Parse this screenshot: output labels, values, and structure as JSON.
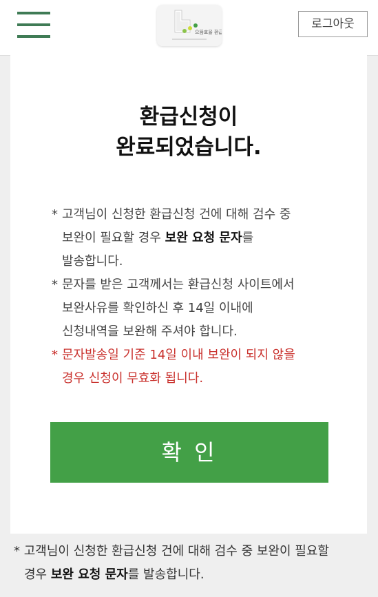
{
  "header": {
    "logout_label": "로그아웃",
    "logo_text": "으뜸효율 환급사업",
    "accent_color": "#3f7b55"
  },
  "main": {
    "title_line1": "환급신청이",
    "title_line2": "완료되었습니다.",
    "notes": [
      {
        "star": "*",
        "line1": "고객님이 신청한 환급신청 건에 대해 검수 중",
        "line2_pre": "보완이 필요할 경우 ",
        "line2_bold": "보완 요청 문자",
        "line2_post": "를",
        "line3": "발송합니다."
      },
      {
        "star": "*",
        "line1": "문자를 받은 고객께서는 환급신청 사이트에서",
        "line2": "보완사유를 확인하신 후 14일 이내에",
        "line3": "신청내역을 보완해 주셔야 합니다."
      },
      {
        "star": "*",
        "line1": "문자발송일 기준 14일 이내 보완이 되지 않을",
        "line2": "경우 신청이 무효화 됩니다.",
        "color": "#c9302c"
      }
    ],
    "confirm_label": "확 인",
    "confirm_color": "#43a047"
  },
  "footer": {
    "star": "*",
    "line1": "고객님이 신청한 환급신청 건에 대해 검수 중 보완이 필요할",
    "line2_pre": "경우 ",
    "line2_bold": "보완 요청 문자",
    "line2_post": "를 발송합니다."
  }
}
